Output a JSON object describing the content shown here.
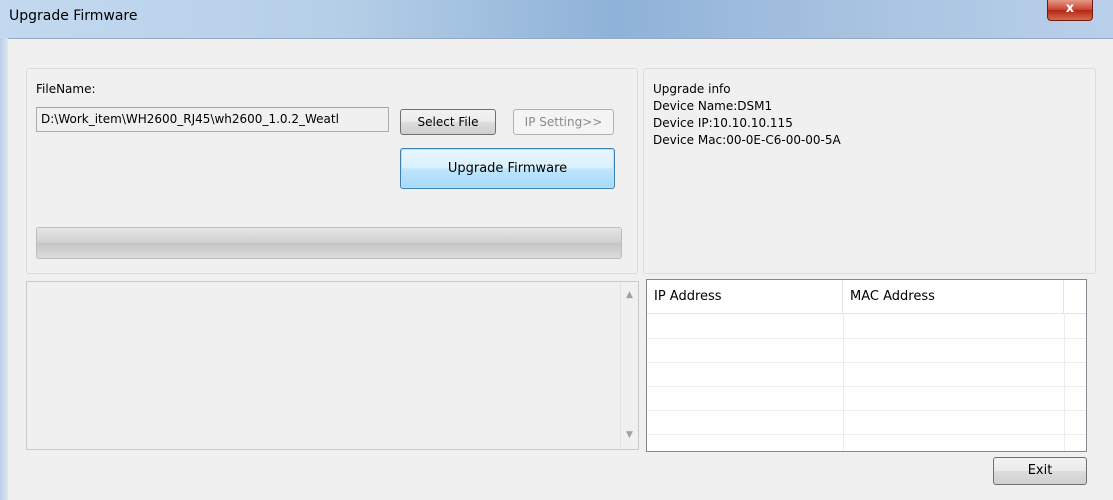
{
  "window": {
    "title": "Upgrade Firmware",
    "close_label": "x"
  },
  "file_panel": {
    "filename_label": "FileName:",
    "file_path": "D:\\Work_item\\WH2600_RJ45\\wh2600_1.0.2_Weatl",
    "select_file_label": "Select File",
    "ip_setting_label": "IP Setting>>",
    "upgrade_button_label": "Upgrade Firmware",
    "progress_fraction": 0
  },
  "info_panel": {
    "heading": "Upgrade info",
    "device_name": "Device Name:DSM1",
    "device_ip": "Device IP:10.10.10.115",
    "device_mac": "Device Mac:00-0E-C6-00-00-5A"
  },
  "log": {
    "scroll_up": "▲",
    "scroll_down": "▼"
  },
  "device_list": {
    "columns": [
      "IP Address",
      "MAC Address"
    ],
    "rows": []
  },
  "footer": {
    "exit_label": "Exit"
  }
}
